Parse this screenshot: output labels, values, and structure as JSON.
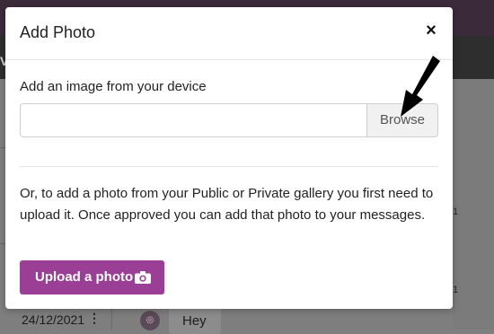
{
  "background": {
    "nav_letter": "V",
    "timestamp_1": "1",
    "timestamp_2": "1",
    "date": "24/12/2021",
    "menu_dots": "⋮",
    "avatar_glyph": "◎",
    "chat_message": "Hey"
  },
  "modal": {
    "title": "Add Photo",
    "close_label": "×",
    "field_label": "Add an image from your device",
    "file_input_value": "",
    "browse_label": "Browse",
    "help_text": "Or, to add a photo from your Public or Private gallery you first need to upload it. Once approved you can add that photo to your messages.",
    "upload_label": "Upload a photo"
  },
  "colors": {
    "accent": "#9b3e96",
    "overlay": "#7f7f7f",
    "header_bar": "#3b2b3a"
  },
  "icons": {
    "close": "close-icon",
    "camera": "camera-icon",
    "arrow": "arrow-annotation-icon"
  }
}
